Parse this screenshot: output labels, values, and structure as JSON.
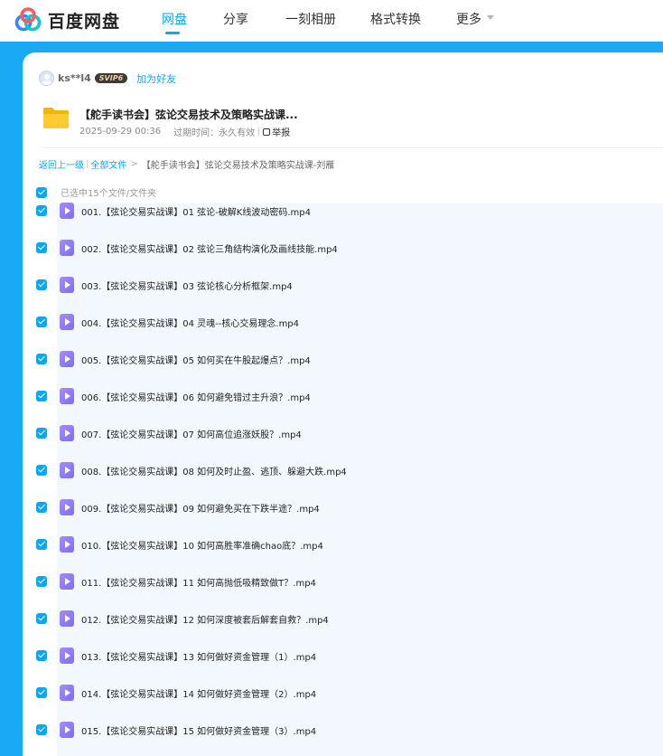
{
  "app": {
    "name": "百度网盘"
  },
  "nav": {
    "items": [
      {
        "label": "网盘",
        "active": true
      },
      {
        "label": "分享"
      },
      {
        "label": "一刻相册"
      },
      {
        "label": "格式转换"
      },
      {
        "label": "更多"
      }
    ]
  },
  "colors": {
    "accent": "#06a7ff",
    "frame": "#1aa9f4",
    "list_bg": "#f3f8ff",
    "video_icon": "#8c78f7"
  },
  "sharer": {
    "name": "ks**l4",
    "badge": "SVIP6",
    "add_friend": "加为好友"
  },
  "share": {
    "title": "【舵手读书会】弦论交易技术及策略实战课...",
    "date": "2025-09-29 00:36",
    "expiry_label": "过期时间：永久有效",
    "report": "举报"
  },
  "breadcrumb": {
    "back": "返回上一级",
    "all": "全部文件",
    "current": "【舵手读书会】弦论交易技术及策略实战课-刘雁"
  },
  "selection": {
    "text": "已选中15个文件/文件夹"
  },
  "files": [
    "001.【弦论交易实战课】01 弦论-破解K线波动密码.mp4",
    "002.【弦论交易实战课】02 弦论三角结构演化及画线技能.mp4",
    "003.【弦论交易实战课】03 弦论核心分析框架.mp4",
    "004.【弦论交易实战课】04 灵魂--核心交易理念.mp4",
    "005.【弦论交易实战课】05 如何买在牛股起爆点？.mp4",
    "006.【弦论交易实战课】06 如何避免错过主升浪？.mp4",
    "007.【弦论交易实战课】07 如何高位追涨妖股？.mp4",
    "008.【弦论交易实战课】08 如何及时止盈、逃顶、躲避大跌.mp4",
    "009.【弦论交易实战课】09 如何避免买在下跌半途？.mp4",
    "010.【弦论交易实战课】10 如何高胜率准确chao底？.mp4",
    "011.【弦论交易实战课】11 如何高抛低吸精致做T？.mp4",
    "012.【弦论交易实战课】12 如何深度被套后解套自救？.mp4",
    "013.【弦论交易实战课】13 如何做好资金管理（1）.mp4",
    "014.【弦论交易实战课】14 如何做好资金管理（2）.mp4",
    "015.【弦论交易实战课】15 如何做好资金管理（3）.mp4"
  ]
}
